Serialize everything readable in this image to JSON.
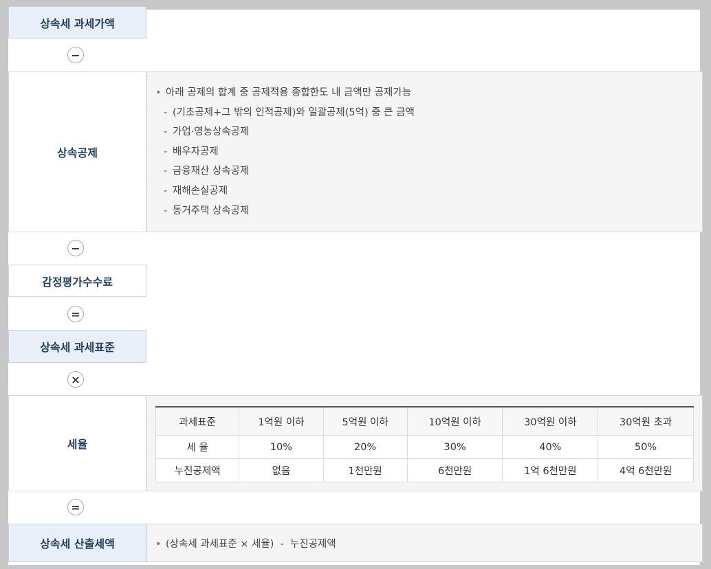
{
  "rows": {
    "taxable_value": {
      "label": "상속세 과세가액"
    },
    "deduction": {
      "label": "상속공제",
      "intro": "아래 공제의 합계 중 공제적용 종합한도 내 금액만 공제가능",
      "items": [
        "(기초공제+그 밖의 인적공제)와 일괄공제(5억) 중 큰 금액",
        "가업·영농상속공제",
        "배우자공제",
        "금융재산 상속공제",
        "재해손실공제",
        "동거주택 상속공제"
      ]
    },
    "appraisal_fee": {
      "label": "감정평가수수료"
    },
    "tax_base": {
      "label": "상속세 과세표준"
    },
    "tax_rate": {
      "label": "세율",
      "table": {
        "headers": [
          "과세표준",
          "1억원 이하",
          "5억원 이하",
          "10억원 이하",
          "30억원 이하",
          "30억원 초과"
        ],
        "rows": [
          [
            "세 율",
            "10%",
            "20%",
            "30%",
            "40%",
            "50%"
          ],
          [
            "누진공제액",
            "없음",
            "1천만원",
            "6천만원",
            "1억 6천만원",
            "4억 6천만원"
          ]
        ]
      }
    },
    "computed_tax": {
      "label": "상속세 산출세액",
      "formula": "(상속세 과세표준 × 세율)  -  누진공제액"
    }
  },
  "operators": {
    "minus1": "−",
    "minus2": "−",
    "equals1": "=",
    "times": "×",
    "equals2": "="
  },
  "bullet": "•",
  "dash": "-",
  "colors": {
    "label_blue_bg": "#e8eff8",
    "label_text": "#1f3d5c",
    "content_bg": "#f5f5f5",
    "page_bg": "#c8c8c8"
  }
}
